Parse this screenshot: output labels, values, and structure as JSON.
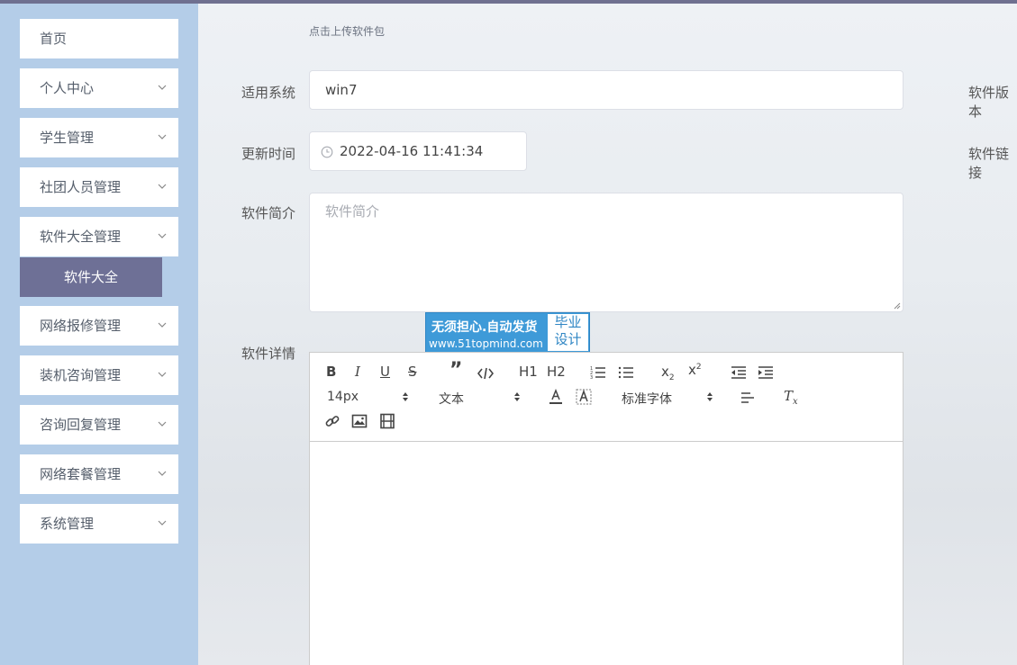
{
  "sidebar": {
    "items": [
      {
        "label": "首页",
        "expandable": false
      },
      {
        "label": "个人中心",
        "expandable": true
      },
      {
        "label": "学生管理",
        "expandable": true
      },
      {
        "label": "社团人员管理",
        "expandable": true
      },
      {
        "label": "软件大全管理",
        "expandable": true
      },
      {
        "label": "网络报修管理",
        "expandable": true
      },
      {
        "label": "装机咨询管理",
        "expandable": true
      },
      {
        "label": "咨询回复管理",
        "expandable": true
      },
      {
        "label": "网络套餐管理",
        "expandable": true
      },
      {
        "label": "系统管理",
        "expandable": true
      }
    ],
    "active_sub": "软件大全"
  },
  "form": {
    "upload_hint": "点击上传软件包",
    "system_label": "适用系统",
    "system_value": "win7",
    "version_label": "软件版本",
    "update_label": "更新时间",
    "update_value": "2022-04-16 11:41:34",
    "link_label": "软件链接",
    "intro_label": "软件简介",
    "intro_placeholder": "软件简介",
    "detail_label": "软件详情"
  },
  "watermark": {
    "line1": "无须担心.自动发货",
    "line2": "www.51topmind.com",
    "right_top": "毕业",
    "right_bottom": "设计"
  },
  "editor": {
    "font_size": "14px",
    "block_type": "文本",
    "font_family": "标准字体",
    "h1": "H1",
    "h2": "H2"
  },
  "colors": {
    "sidebar_bg": "#b4cde8",
    "active_bg": "#6e7096",
    "topbar": "#6f7090",
    "watermark_blue": "#3e9ad8"
  }
}
